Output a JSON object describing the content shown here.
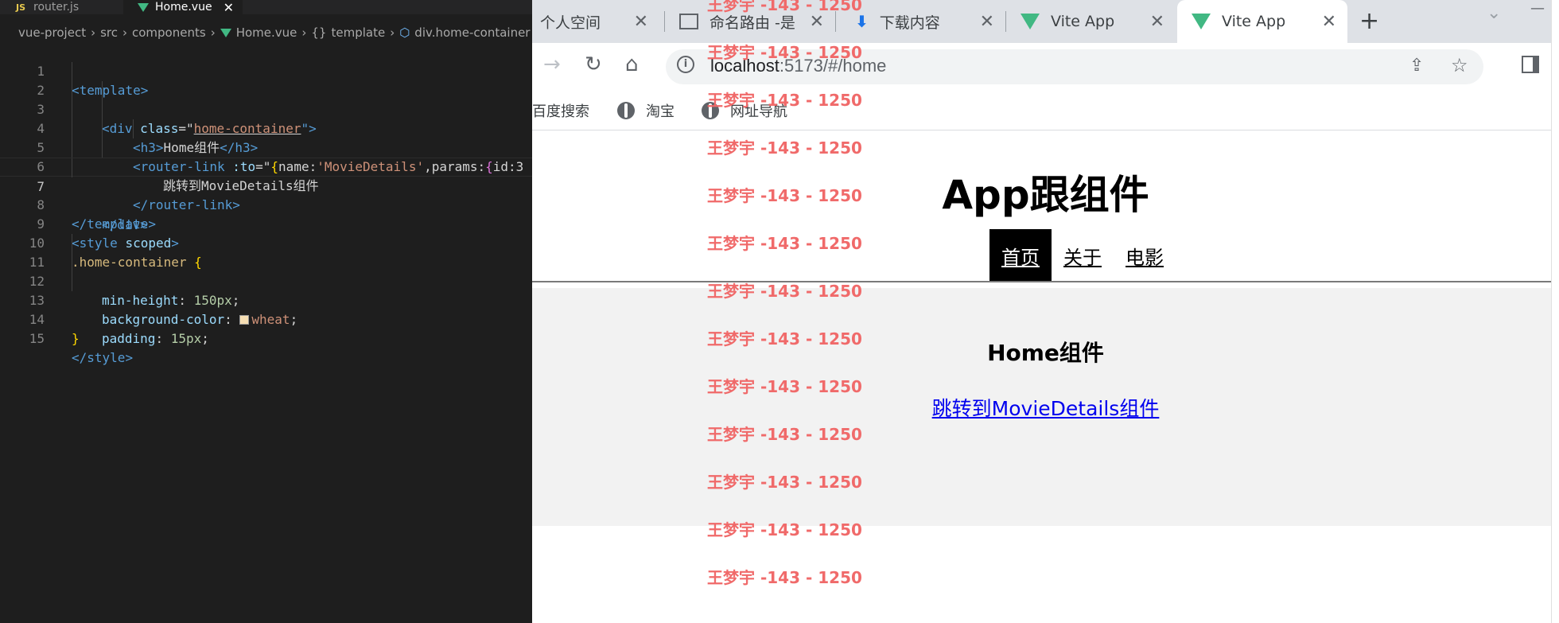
{
  "editor": {
    "tabs": [
      {
        "badge": "JS",
        "label": "router.js"
      },
      {
        "label": "Home.vue",
        "close": "✕"
      }
    ],
    "breadcrumb": {
      "parts": [
        "vue-project",
        "src",
        "components",
        "Home.vue",
        "template",
        "div.home-container"
      ],
      "sep": "›",
      "braces": "{}"
    },
    "lines": {
      "n1": "1",
      "n2": "2",
      "n3": "3",
      "n4": "4",
      "n5": "5",
      "n6": "6",
      "n7": "7",
      "n8": "8",
      "n9": "9",
      "n10": "10",
      "n11": "11",
      "n12": "12",
      "n13": "13",
      "n14": "14",
      "n15": "15",
      "l1_open": "<",
      "l1_tag": "template",
      "l1_close": ">",
      "l2_open": "<",
      "l2_tag": "div",
      "l2_attr": " class",
      "l2_eq": "=\"",
      "l2_val": "home-container",
      "l2_end": "\">",
      "l3_open": "<",
      "l3_tag": "h3",
      "l3_close": ">",
      "l3_text": "Home组件",
      "l3_endopen": "</",
      "l3_endtag": "h3",
      "l3_endclose": ">",
      "l4_open": "<",
      "l4_tag": "router-link",
      "l4_attr": " :to",
      "l4_eq": "=\"",
      "l4_brace": "{",
      "l4_key": "name:",
      "l4_str": "'MovieDetails'",
      "l4_rest": ",params:",
      "l4_brace2": "{",
      "l4_id": "id:3",
      "l5_text": "跳转到MovieDetails组件",
      "l6_open": "</",
      "l6_tag": "router-link",
      "l6_close": ">",
      "l7_open": "</",
      "l7_tag": "div",
      "l7_close": ">",
      "l8_open": "</",
      "l8_tag": "template",
      "l8_close": ">",
      "l9_open": "<",
      "l9_tag": "style",
      "l9_attr": " scoped",
      "l9_close": ">",
      "l10_sel": ".home-container",
      "l10_brace": " {",
      "l11_prop": "min-height",
      "l11_colon": ": ",
      "l11_val": "150px",
      "l11_semi": ";",
      "l12_prop": "background-color",
      "l12_colon": ": ",
      "l12_val": "wheat",
      "l12_semi": ";",
      "l13_prop": "padding",
      "l13_colon": ": ",
      "l13_val": "15px",
      "l13_semi": ";",
      "l14_brace": "}",
      "l15_open": "</",
      "l15_tag": "style",
      "l15_close": ">"
    }
  },
  "browser": {
    "tabs": [
      {
        "label": "个人空间",
        "close": "✕"
      },
      {
        "label": "命名路由 -是",
        "close": "✕"
      },
      {
        "label": "下载内容",
        "close": "✕"
      },
      {
        "label": "Vite App",
        "close": "✕"
      },
      {
        "label": "Vite App",
        "close": "✕"
      }
    ],
    "new_tab": "+",
    "tab_menu": "⌄",
    "minimize": "—",
    "nav": {
      "back": "→",
      "reload": "↻",
      "home": "⌂"
    },
    "url": {
      "host": "localhost",
      "rest": ":5173/#/home"
    },
    "info_icon": "i",
    "share": "⇪",
    "star": "☆",
    "bookmarks": [
      "百度搜索",
      "淘宝",
      "网址导航"
    ]
  },
  "page": {
    "title": "App跟组件",
    "nav": [
      "首页",
      "关于",
      "电影"
    ],
    "home_heading": "Home组件",
    "home_link": "跳转到MovieDetails组件"
  },
  "watermark": {
    "text": "王梦宇 -143 - 1250",
    "count": 13
  },
  "colors": {
    "editor_bg": "#1e1e1e",
    "vue_green": "#41b883",
    "watermark_red": "#f06a6a",
    "link_blue": "#0000ee"
  }
}
